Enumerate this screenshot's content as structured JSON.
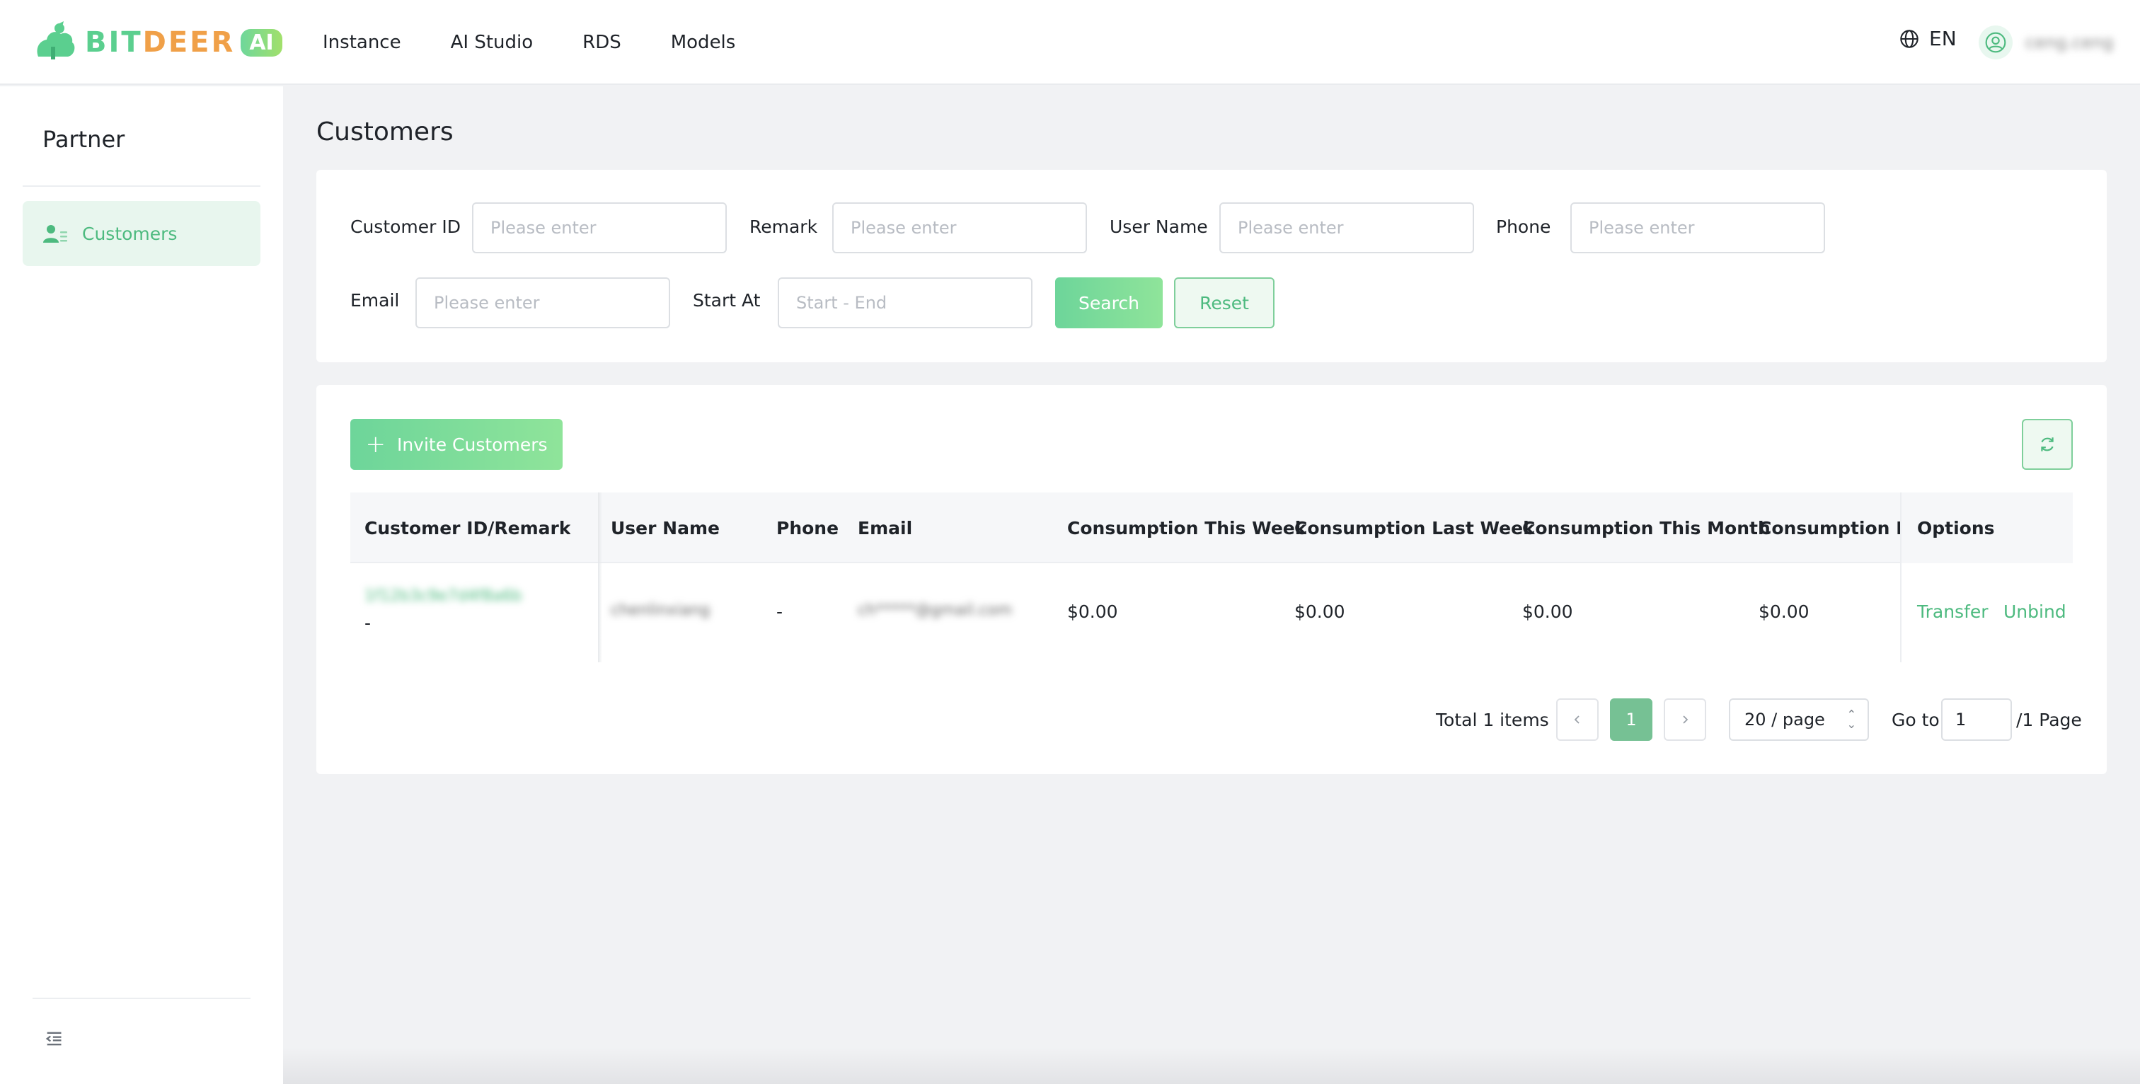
{
  "app": {
    "brand_part1": "BIT",
    "brand_part2": "DEER",
    "brand_ai": "AI",
    "nav": [
      "Instance",
      "AI Studio",
      "RDS",
      "Models"
    ],
    "language": "EN",
    "username": "ceng.ceng",
    "accent_color": "#4dba7f"
  },
  "sidebar": {
    "title": "Partner",
    "items": [
      {
        "label": "Customers",
        "icon": "user-list-icon",
        "active": true
      }
    ]
  },
  "page": {
    "title": "Customers"
  },
  "filters": {
    "customer_id_label": "Customer ID",
    "remark_label": "Remark",
    "user_name_label": "User Name",
    "phone_label": "Phone",
    "email_label": "Email",
    "start_at_label": "Start At",
    "placeholder": "Please enter",
    "date_placeholder": "Start - End",
    "search_label": "Search",
    "reset_label": "Reset"
  },
  "list": {
    "invite_label": "Invite Customers",
    "columns": [
      "Customer ID/Remark",
      "User Name",
      "Phone",
      "Email",
      "Consumption This Week",
      "Consumption Last Week",
      "Consumption This Month",
      "Consumption Last Month",
      "Options"
    ],
    "rows": [
      {
        "customer_id": "1f12b3c9e7d4f8a6b",
        "remark": "-",
        "user_name": "chenlinxiang",
        "phone": "-",
        "email": "ch*****@gmail.com",
        "this_week": "$0.00",
        "last_week": "$0.00",
        "this_month": "$0.00",
        "last_month": "$0.00",
        "action_transfer": "Transfer",
        "action_unbind": "Unbind"
      }
    ]
  },
  "pagination": {
    "total_text": "Total 1 items",
    "current_page": "1",
    "page_size": "20 / page",
    "goto_label": "Go to",
    "goto_value": "1",
    "pages_text": "/1 Page"
  }
}
